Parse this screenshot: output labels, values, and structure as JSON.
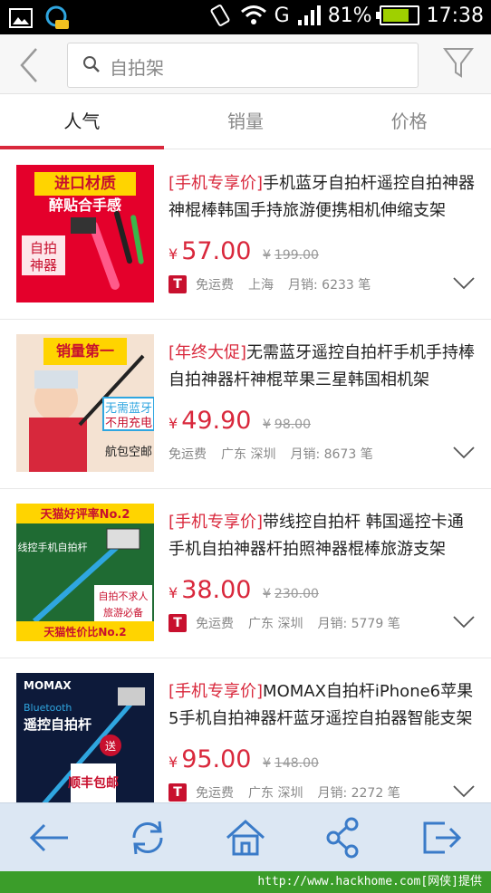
{
  "status_bar": {
    "carrier_letter": "G",
    "battery": "81%",
    "battery_level": 0.81,
    "time": "17:38"
  },
  "search": {
    "query": "自拍架",
    "icons": {
      "back": "chevron-left-icon",
      "search": "search-icon",
      "filter": "funnel-icon"
    }
  },
  "tabs": [
    {
      "label": "人气",
      "active": true
    },
    {
      "label": "销量",
      "active": false
    },
    {
      "label": "价格",
      "active": false
    }
  ],
  "products": [
    {
      "tag": "[手机专享价]",
      "title": "手机蓝牙自拍杆遥控自拍神器神棍棒韩国手持旅游便携相机伸缩支架",
      "currency": "¥",
      "price": "57.00",
      "old_price": "199.00",
      "badge": "T",
      "shipping": "免运费",
      "location": "上海",
      "sales": "月销: 6233 笔",
      "thumb_text": [
        "进口材质",
        "醉贴合手感",
        "自拍",
        "神器"
      ],
      "thumb_bg": "#e4002b"
    },
    {
      "tag": "[年终大促]",
      "title": "无需蓝牙遥控自拍杆手机手持棒自拍神器杆神棍苹果三星韩国相机架",
      "currency": "¥",
      "price": "49.90",
      "old_price": "98.00",
      "badge": "",
      "shipping": "免运费",
      "location": "广东 深圳",
      "sales": "月销: 8673 笔",
      "thumb_text": [
        "销量第一",
        "无需蓝牙",
        "不用充电",
        "航包空邮"
      ],
      "thumb_bg": "#f2c9a8"
    },
    {
      "tag": "[手机专享价]",
      "title": "带线控自拍杆 韩国遥控卡通手机自拍神器杆拍照神器棍棒旅游支架",
      "currency": "¥",
      "price": "38.00",
      "old_price": "230.00",
      "badge": "T",
      "shipping": "免运费",
      "location": "广东 深圳",
      "sales": "月销: 5779 笔",
      "thumb_text": [
        "天猫好评率No.2",
        "线控手机自拍杆",
        "自拍不求人",
        "旅游必备",
        "天猫性价比No.2"
      ],
      "thumb_bg": "#2a7a3a"
    },
    {
      "tag": "[手机专享价]",
      "title": "MOMAX自拍杆iPhone6苹果5手机自拍神器杆蓝牙遥控自拍器智能支架",
      "currency": "¥",
      "price": "95.00",
      "old_price": "148.00",
      "badge": "T",
      "shipping": "免运费",
      "location": "广东 深圳",
      "sales": "月销: 2272 笔",
      "thumb_text": [
        "MOMAX",
        "Bluetooth",
        "遥控自拍杆",
        "顺丰包邮",
        "送"
      ],
      "thumb_bg": "#0d1a3a"
    }
  ],
  "bottom_nav": [
    {
      "icon": "arrow-left-icon"
    },
    {
      "icon": "refresh-icon"
    },
    {
      "icon": "home-icon"
    },
    {
      "icon": "share-icon"
    },
    {
      "icon": "exit-icon"
    }
  ],
  "footer": {
    "text": "http://www.hackhome.com[网侠]提供"
  },
  "colors": {
    "accent": "#d9283c",
    "nav_bg": "#dce7f3",
    "nav_icon": "#3a7bc8"
  }
}
